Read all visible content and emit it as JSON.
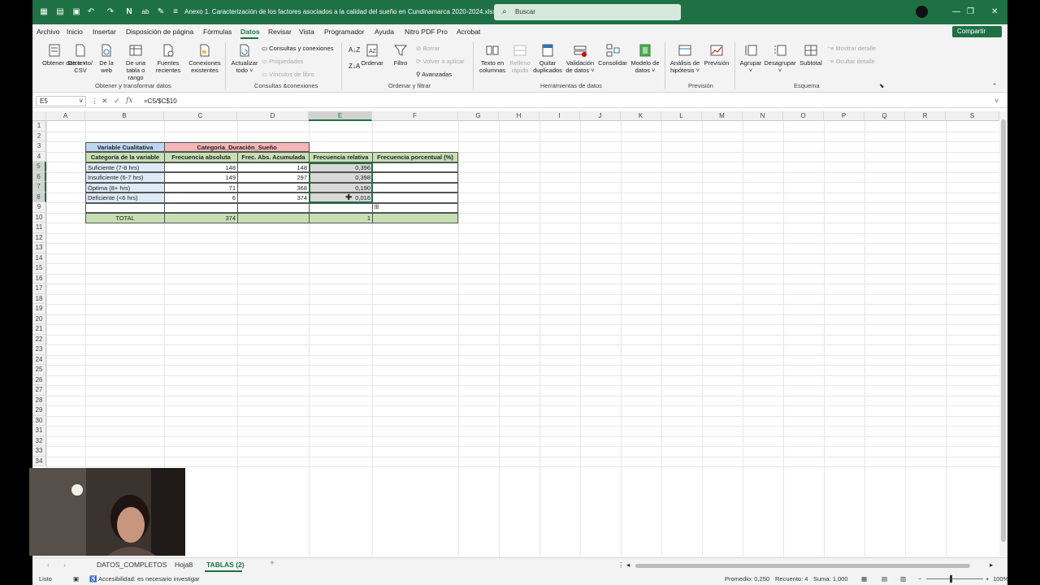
{
  "titlebar": {
    "title": "Anexo 1. Caracterización de los factores asociados a la calidad del sueño en Cundinamarca 2020-2024.xlsx  -...",
    "search_placeholder": "Buscar",
    "autosave_label": "N",
    "ab_label": "ab"
  },
  "menu": {
    "items": [
      "Archivo",
      "Inicio",
      "Insertar",
      "Disposición de página",
      "Fórmulas",
      "Datos",
      "Revisar",
      "Vista",
      "Programador",
      "Ayuda",
      "Nitro PDF Pro",
      "Acrobat"
    ],
    "active": "Datos",
    "share_label": "Compartir"
  },
  "ribbon": {
    "get_data": {
      "obtener": "Obtener datos ˅",
      "texto_csv": "De texto/ CSV",
      "web": "De la web",
      "tabla": "De una tabla o rango",
      "fuentes": "Fuentes recientes",
      "conexiones": "Conexiones existentes",
      "group": "Obtener y transformar datos"
    },
    "queries": {
      "actualizar": "Actualizar todo ˅",
      "consultas": "Consultas y conexiones",
      "propiedades": "Propiedades",
      "vinculos": "Vínculos de libro",
      "group": "Consultas &conexiones"
    },
    "sort": {
      "ordenar": "Ordenar",
      "filtro": "Filtro",
      "borrar": "Borrar",
      "volver": "Volver a aplicar",
      "avanzadas": "Avanzadas",
      "group": "Ordenar y filtrar"
    },
    "tools": {
      "texto_columnas": "Texto en columnas",
      "relleno": "Relleno rápido",
      "quitar": "Quitar duplicados",
      "validacion": "Validación de datos ˅",
      "consolidar": "Consolidar",
      "modelo": "Modelo de datos ˅",
      "group": "Herramientas de datos"
    },
    "forecast": {
      "analisis": "Análisis de hipótesis ˅",
      "prevision": "Previsión",
      "group": "Previsión"
    },
    "outline": {
      "agrupar": "Agrupar ˅",
      "desagrupar": "Desagrupar ˅",
      "subtotal": "Subtotal",
      "mostrar": "Mostrar detalle",
      "ocultar": "Ocultar detalle",
      "group": "Esquema"
    }
  },
  "formula_bar": {
    "cell_ref": "E5",
    "formula": "=C5/$C$10"
  },
  "columns": [
    "A",
    "B",
    "C",
    "D",
    "E",
    "F",
    "G",
    "H",
    "I",
    "J",
    "K",
    "L",
    "M",
    "N",
    "O",
    "P",
    "Q",
    "R",
    "S"
  ],
  "rows": [
    "1",
    "2",
    "3",
    "4",
    "5",
    "6",
    "7",
    "8",
    "9",
    "10",
    "11",
    "12",
    "13",
    "14",
    "15",
    "16",
    "17",
    "18",
    "19",
    "20",
    "21",
    "22",
    "23",
    "24",
    "25",
    "26",
    "27",
    "28",
    "29",
    "30",
    "31",
    "32",
    "33",
    "34"
  ],
  "table": {
    "title_left": "Variable Cualitativa",
    "title_right": "Categoria_Duración_Sueño",
    "headers": [
      "Categoría de la variable",
      "Frecuencia absoluta",
      "Frec. Abs. Acumulada",
      "Frecuencia relativa",
      "Frecuencia porcentual (%)"
    ],
    "rows": [
      [
        "Suficiente (7-8 hrs)",
        "148",
        "148",
        "0,396",
        ""
      ],
      [
        "Insuficiente (6-7 hrs)",
        "149",
        "297",
        "0,398",
        ""
      ],
      [
        "Óptima (8+ hrs)",
        "71",
        "368",
        "0,190",
        ""
      ],
      [
        "Deficiente (<6 hrs)",
        "6",
        "374",
        "0,016",
        ""
      ]
    ],
    "total": [
      "TOTAL",
      "374",
      "",
      "1",
      ""
    ]
  },
  "sheets": {
    "tabs": [
      "DATOS_COMPLETOS",
      "Hoja8",
      "TABLAS (2)"
    ],
    "active": "TABLAS (2)",
    "add": "+"
  },
  "status": {
    "ready": "Listo",
    "accessibility": "Accesibilidad: es necesario investigar",
    "average": "Promedio: 0,250",
    "count": "Recuento: 4",
    "sum": "Suma: 1,000",
    "zoom": "100%"
  },
  "colors": {
    "excel_green": "#1e7145",
    "header_blue": "#bdd7ee",
    "header_pink": "#f4b6b6",
    "header_green": "#c6e0b4",
    "label_blue": "#ddebf7",
    "selected_gray": "#d9d9d9"
  }
}
